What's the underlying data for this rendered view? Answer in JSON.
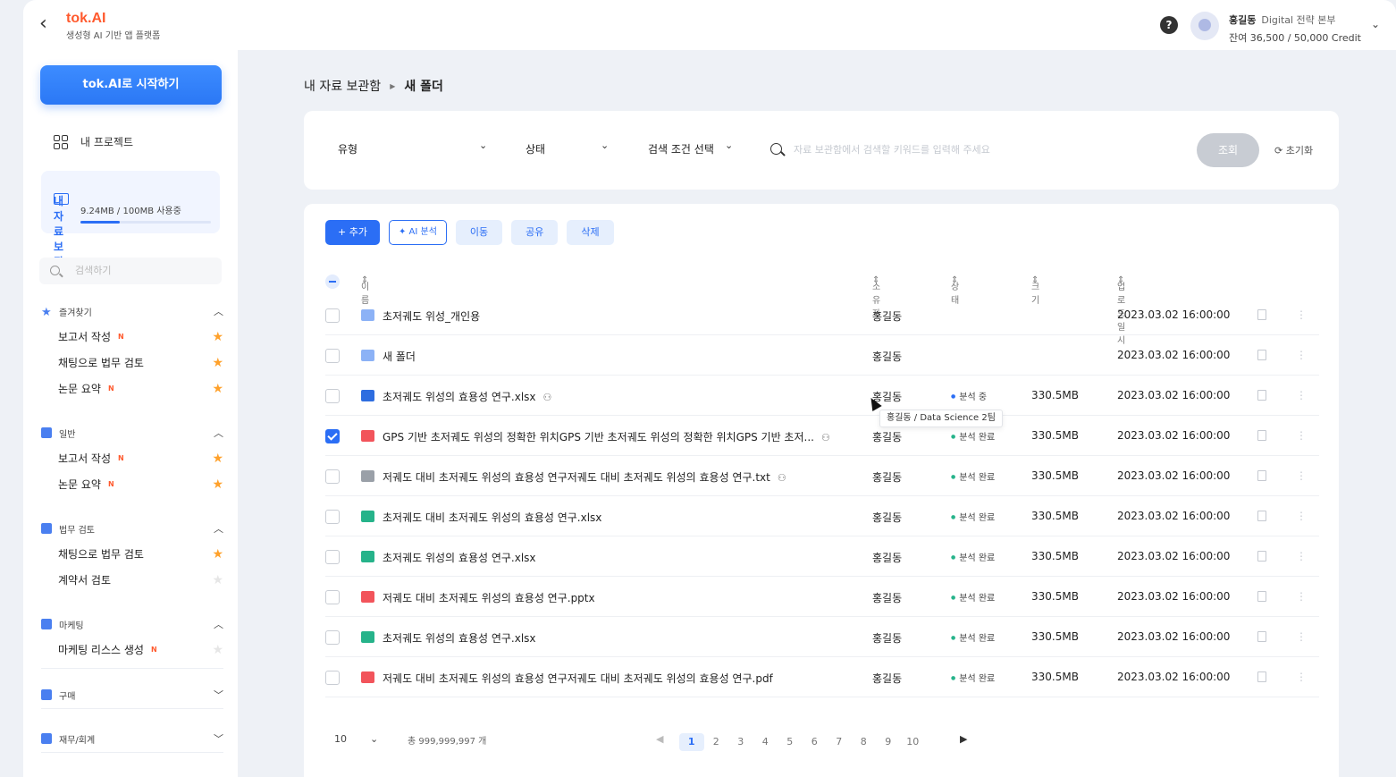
{
  "header": {
    "logo_title": "tok.AI",
    "logo_subtitle": "생성형 AI 기반 앱 플랫폼",
    "help_icon": "?",
    "user_name": "홍길동",
    "user_dept": "Digital 전략 본부",
    "credit": "잔여 36,500 / 50,000 Credit"
  },
  "sidebar": {
    "start_button": "tok.AI로 시작하기",
    "projects_label": "내 프로젝트",
    "vault_label": "내 자료 보관함",
    "vault_usage": "9.24MB / 100MB 사용중",
    "vault_usage_fraction": 0.3,
    "search_placeholder": "검색하기",
    "sections": [
      {
        "title": "즐겨찾기",
        "icon": "star-icon",
        "items": [
          {
            "label": "보고서 작성",
            "new": "N",
            "starred": true
          },
          {
            "label": "채팅으로 법무 검토",
            "new": "",
            "starred": true
          },
          {
            "label": "논문 요약",
            "new": "N",
            "starred": true
          }
        ]
      },
      {
        "title": "일반",
        "icon": "document-icon",
        "items": [
          {
            "label": "보고서 작성",
            "new": "N",
            "starred": true
          },
          {
            "label": "논문 요약",
            "new": "N",
            "starred": true
          }
        ]
      },
      {
        "title": "법무 검토",
        "icon": "legal-icon",
        "items": [
          {
            "label": "채팅으로 법무 검토",
            "new": "",
            "starred": true
          },
          {
            "label": "계약서 검토",
            "new": "",
            "starred": false
          }
        ]
      },
      {
        "title": "마케팅",
        "icon": "megaphone-icon",
        "items": [
          {
            "label": "마케팅 리스스 생성",
            "new": "N",
            "starred": false
          }
        ]
      },
      {
        "title": "구매",
        "icon": "cart-icon",
        "items": []
      },
      {
        "title": "재무/회계",
        "icon": "chart-icon",
        "items": []
      }
    ]
  },
  "breadcrumb": {
    "root": "내 자료 보관함",
    "current": "새 폴더"
  },
  "filters": {
    "type": "유형",
    "status": "상태",
    "condition": "검색 조건 선택",
    "search_placeholder": "자료 보관함에서 검색할 키워드를 입력해 주세요",
    "query_button": "조회",
    "reset_button": "초기화"
  },
  "actions": {
    "add": "+ 추가",
    "ai": "AI 분석",
    "move": "이동",
    "share": "공유",
    "delete": "삭제"
  },
  "columns": {
    "name": "이름",
    "owner": "소유자",
    "status": "상태",
    "size": "크기",
    "date": "업로드 일시"
  },
  "rows": [
    {
      "name": "초저궤도 위성_개인용",
      "kind": "folder",
      "shared": false,
      "owner": "홍길동",
      "status": "",
      "size": "",
      "date": "2023.03.02 16:00:00",
      "checked": false
    },
    {
      "name": "새 폴더",
      "kind": "folder",
      "shared": false,
      "owner": "홍길동",
      "status": "",
      "size": "",
      "date": "2023.03.02 16:00:00",
      "checked": false
    },
    {
      "name": "초저궤도 위성의 효용성 연구.xlsx",
      "kind": "xlsx",
      "shared": true,
      "owner": "홍길동",
      "status": "분석 중",
      "size": "330.5MB",
      "date": "2023.03.02 16:00:00",
      "checked": false
    },
    {
      "name": "GPS 기반 초저궤도 위성의 정확한 위치GPS 기반 초저궤도 위성의 정확한 위치GPS 기반 초저...",
      "kind": "red",
      "shared": true,
      "owner": "홍길동",
      "status": "분석 완료",
      "size": "330.5MB",
      "date": "2023.03.02 16:00:00",
      "checked": true
    },
    {
      "name": "저궤도 대비 초저궤도 위성의 효용성 연구저궤도 대비 초저궤도 위성의 효용성 연구.txt",
      "kind": "gray",
      "shared": true,
      "owner": "홍길동",
      "status": "분석 완료",
      "size": "330.5MB",
      "date": "2023.03.02 16:00:00",
      "checked": false
    },
    {
      "name": "초저궤도 대비 초저궤도 위성의 효용성 연구.xlsx",
      "kind": "green",
      "shared": false,
      "owner": "홍길동",
      "status": "분석 완료",
      "size": "330.5MB",
      "date": "2023.03.02 16:00:00",
      "checked": false
    },
    {
      "name": "초저궤도 위성의 효용성 연구.xlsx",
      "kind": "green",
      "shared": false,
      "owner": "홍길동",
      "status": "분석 완료",
      "size": "330.5MB",
      "date": "2023.03.02 16:00:00",
      "checked": false
    },
    {
      "name": "저궤도 대비 초저궤도 위성의 효용성 연구.pptx",
      "kind": "red",
      "shared": false,
      "owner": "홍길동",
      "status": "분석 완료",
      "size": "330.5MB",
      "date": "2023.03.02 16:00:00",
      "checked": false
    },
    {
      "name": "초저궤도 위성의 효용성 연구.xlsx",
      "kind": "green",
      "shared": false,
      "owner": "홍길동",
      "status": "분석 완료",
      "size": "330.5MB",
      "date": "2023.03.02 16:00:00",
      "checked": false
    },
    {
      "name": "저궤도 대비 초저궤도 위성의 효용성 연구저궤도 대비 초저궤도 위성의 효용성 연구.pdf",
      "kind": "red",
      "shared": false,
      "owner": "홍길동",
      "status": "분석 완료",
      "size": "330.5MB",
      "date": "2023.03.02 16:00:00",
      "checked": false
    }
  ],
  "tooltip": "홍길동 / Data Science 2팀",
  "footer": {
    "page_size": "10",
    "total": "총 999,999,997 개",
    "pages": [
      "1",
      "2",
      "3",
      "4",
      "5",
      "6",
      "7",
      "8",
      "9",
      "10"
    ],
    "current_page": "1"
  }
}
